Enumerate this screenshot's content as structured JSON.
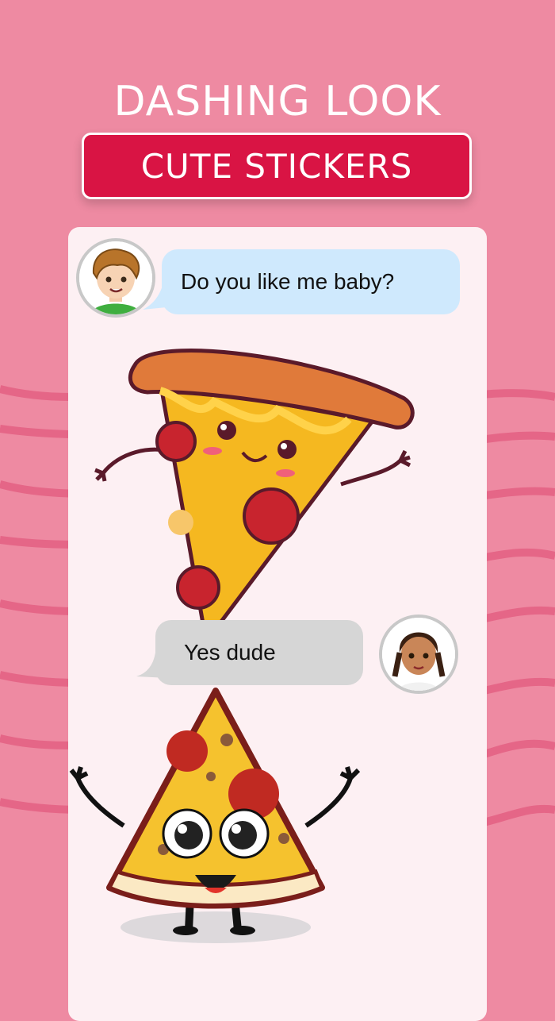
{
  "header": {
    "headline": "DASHING LOOK",
    "banner_label": "CUTE STICKERS"
  },
  "chat": {
    "incoming_message": "Do you like me baby?",
    "outgoing_message": "Yes dude"
  },
  "colors": {
    "background": "#ee8aa2",
    "banner": "#d91444",
    "incoming_bubble": "#cfe9fd",
    "outgoing_bubble": "#d6d6d6",
    "chat_panel": "#fdf0f3"
  },
  "icons": {
    "boy_avatar": "boy-avatar-icon",
    "girl_avatar": "girl-avatar-icon",
    "pizza_sticker_1": "pizza-slice-sticker",
    "pizza_sticker_2": "pizza-slice-sticker"
  }
}
